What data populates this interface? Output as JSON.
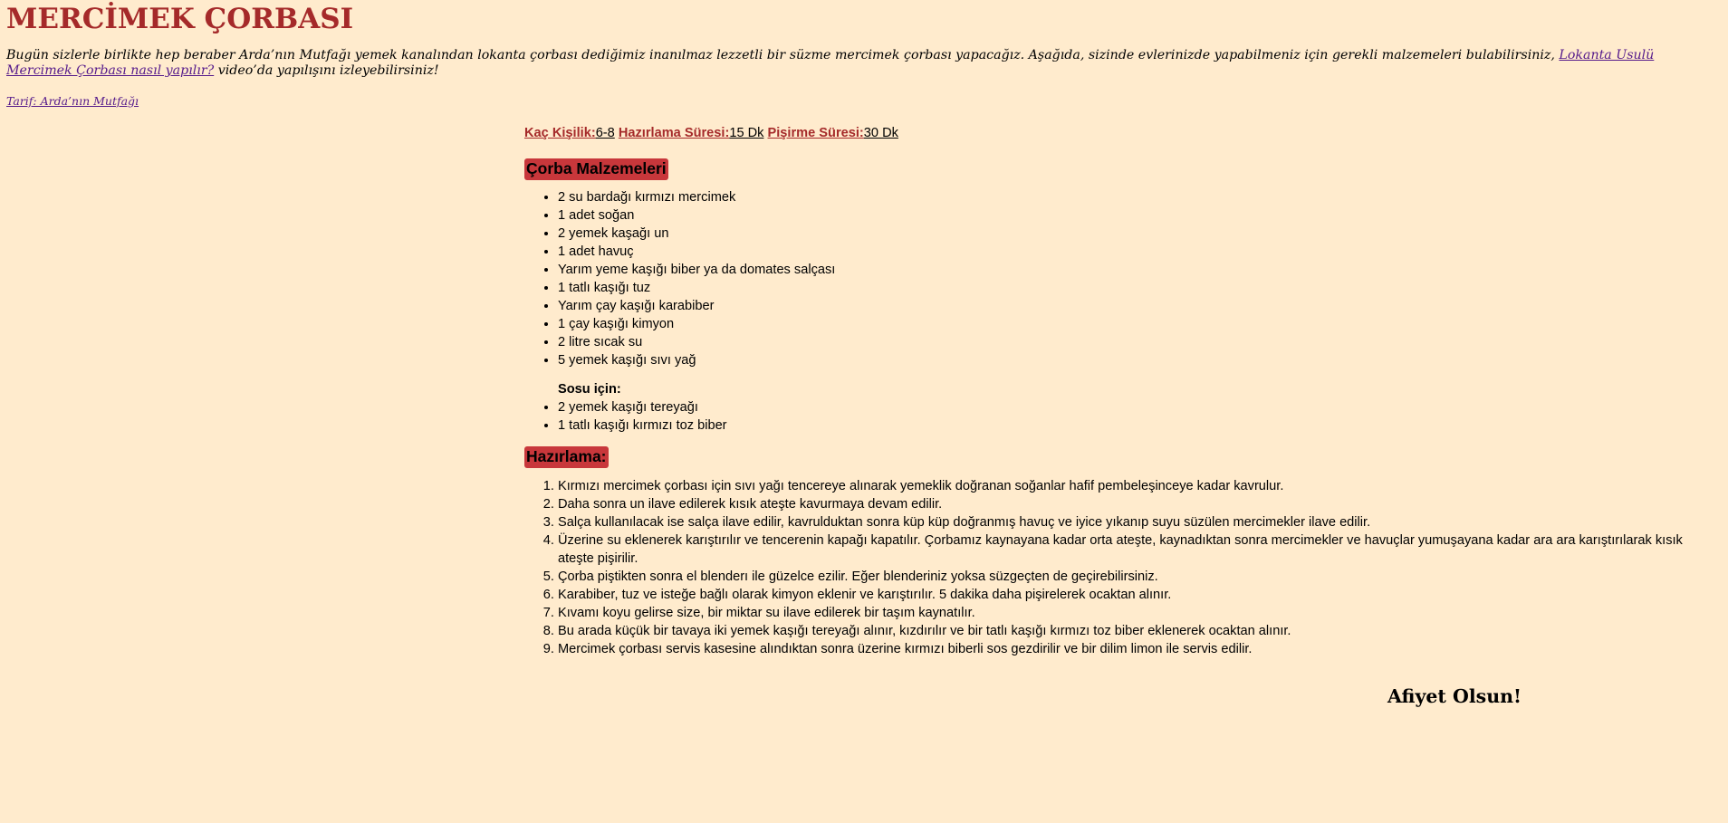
{
  "header": {
    "title": "MERCİMEK ÇORBASI",
    "intro_text": "Bugün sizlerle birlikte hep beraber Arda’nın Mutfağı yemek kanalından lokanta çorbası dediğimiz inanılmaz lezzetli bir süzme mercimek çorbası yapacağız. Aşağıda, sizinde evlerinizde yapabilmeniz için gerekli malzemeleri bulabilirsiniz,",
    "intro_link": "Lokanta Usulü Mercimek Çorbası nasıl yapılır?",
    "intro_suffix": "video’da yapılışını izleyebilirsiniz!",
    "credit_link": "Tarif: Arda’nın Mutfağı"
  },
  "meta": {
    "servings_label": "Kaç Kişilik:",
    "servings_value": "6-8",
    "prep_label": "Hazırlama Süresi:",
    "prep_value": "15 Dk",
    "cook_label": "Pişirme Süresi:",
    "cook_value": "30 Dk"
  },
  "ingredients": {
    "heading": "Çorba Malzemeleri",
    "items": [
      "2 su bardağı kırmızı mercimek",
      "1 adet soğan",
      "2 yemek kaşağı un",
      "1 adet havuç",
      "Yarım yeme kaşığı biber ya da domates salçası",
      "1 tatlı kaşığı tuz",
      "Yarım çay kaşığı karabiber",
      "1 çay kaşığı kimyon",
      "2 litre sıcak su",
      "5 yemek kaşığı sıvı yağ"
    ],
    "sauce_title": "Sosu için:",
    "sauce_items": [
      "2 yemek kaşığı tereyağı",
      "1 tatlı kaşığı kırmızı toz biber"
    ]
  },
  "preparation": {
    "heading": "Hazırlama:",
    "steps": [
      "Kırmızı mercimek çorbası için sıvı yağı tencereye alınarak yemeklik doğranan soğanlar hafif pembeleşinceye kadar kavrulur.",
      "Daha sonra un ilave edilerek kısık ateşte kavurmaya devam edilir.",
      "Salça kullanılacak ise salça ilave edilir, kavrulduktan sonra küp küp doğranmış havuç ve iyice yıkanıp suyu süzülen mercimekler ilave edilir.",
      "Üzerine su eklenerek karıştırılır ve tencerenin kapağı kapatılır. Çorbamız kaynayana kadar orta ateşte, kaynadıktan sonra mercimekler ve havuçlar yumuşayana kadar ara ara karıştırılarak kısık ateşte pişirilir.",
      "Çorba piştikten sonra el blenderı ile güzelce ezilir. Eğer blenderiniz yoksa süzgeçten de geçirebilirsiniz.",
      "Karabiber, tuz ve isteğe bağlı olarak kimyon eklenir ve karıştırılır. 5 dakika daha pişirelerek ocaktan alınır.",
      "Kıvamı koyu gelirse size, bir miktar su ilave edilerek bir taşım kaynatılır.",
      "Bu arada küçük bir tavaya iki yemek kaşığı tereyağı alınır, kızdırılır ve bir tatlı kaşığı kırmızı toz biber eklenerek ocaktan alınır.",
      "Mercimek çorbası servis kasesine alındıktan sonra üzerine kırmızı biberli sos gezdirilir ve bir dilim limon ile servis edilir."
    ]
  },
  "footer": {
    "closing": "Afiyet Olsun!"
  },
  "colors": {
    "background": "#ffebcd",
    "title": "#a52a2a",
    "heading_bg": "#c8373b",
    "link": "#551a8b"
  }
}
